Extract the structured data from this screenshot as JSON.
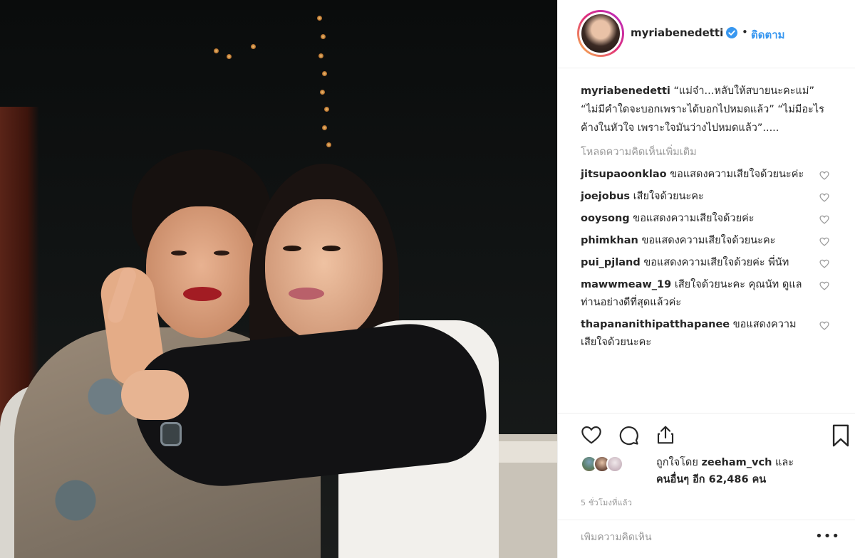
{
  "post": {
    "username": "myriabenedetti",
    "follow_label": "ติดตาม",
    "dot": "•",
    "caption": "“แม่จ๋า...หลับให้สบายนะคะแม่” “ไม่มีคำใดจะบอกเพราะได้บอกไปหมดแล้ว” “ไม่มีอะไรค้างในหัวใจ เพราะใจมันว่างไปหมดแล้ว”.....",
    "load_more": "โหลดความคิดเห็นเพิ่มเติม",
    "comments": [
      {
        "user": "jitsupaoonklao",
        "text": "ขอแสดงความเสียใจด้วยนะค่ะ"
      },
      {
        "user": "joejobus",
        "text": "เสียใจด้วยนะคะ"
      },
      {
        "user": "ooysong",
        "text": "ขอแสดงความเสียใจด้วยค่ะ"
      },
      {
        "user": "phimkhan",
        "text": "ขอแสดงความเสียใจด้วยนะคะ"
      },
      {
        "user": "pui_pjland",
        "text": "ขอแสดงความเสียใจด้วยค่ะ พี่นัท"
      },
      {
        "user": "mawwmeaw_19",
        "text": "เสียใจด้วยนะคะ คุณนัท ดูแลท่านอย่างดีที่สุดแล้วค่ะ"
      },
      {
        "user": "thapananithipatthapanee",
        "text": "ขอแสดงความเสียใจด้วยนะคะ"
      }
    ],
    "likes": {
      "prefix": "ถูกใจโดย",
      "user": "zeeham_vch",
      "and": "และ",
      "others": "คนอื่นๆ อีก 62,486 คน"
    },
    "time_ago": "5 ชั่วโมงที่แล้ว",
    "add_comment_placeholder": "เพิ่มความคิดเห็น",
    "more_label": "•••"
  },
  "icons": {
    "like": "heart-icon",
    "comment": "comment-icon",
    "share": "share-icon",
    "save": "bookmark-icon",
    "verified": "verified-badge-icon"
  },
  "colors": {
    "accent": "#3897f0",
    "text": "#262626",
    "muted": "#999999",
    "border": "#efefef"
  }
}
